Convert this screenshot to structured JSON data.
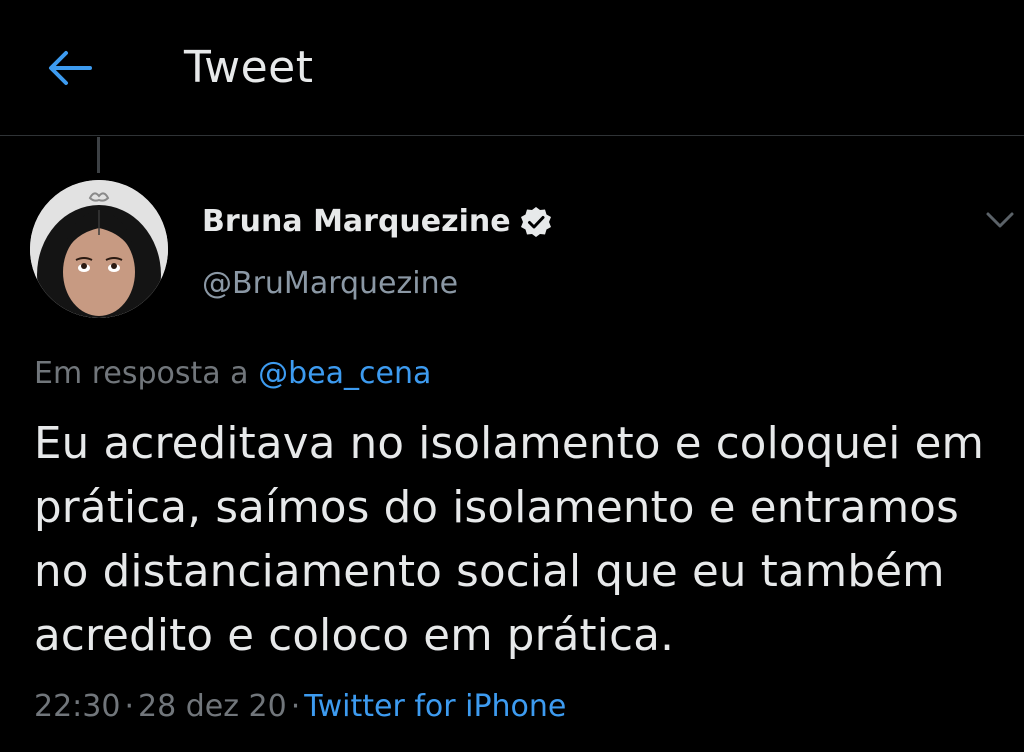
{
  "header": {
    "title": "Tweet",
    "back_icon": "arrow-left-icon"
  },
  "colors": {
    "background": "#000000",
    "accent": "#3d9bf0",
    "text": "#e7e9ea",
    "muted": "#71767b"
  },
  "tweet": {
    "author_name": "Bruna Marquezine",
    "author_handle": "@BruMarquezine",
    "verified_icon": "verified-badge-icon",
    "menu_icon": "chevron-down-icon",
    "reply_prefix": "Em resposta a",
    "reply_to": "@bea_cena",
    "text": "Eu acreditava no isolamento e coloquei em prática, saímos do isolamento e entramos no distanciamento social que eu também acredito e coloco em prática.",
    "time": "22:30",
    "date": "28 dez 20",
    "separator": "·",
    "source": "Twitter for iPhone"
  }
}
